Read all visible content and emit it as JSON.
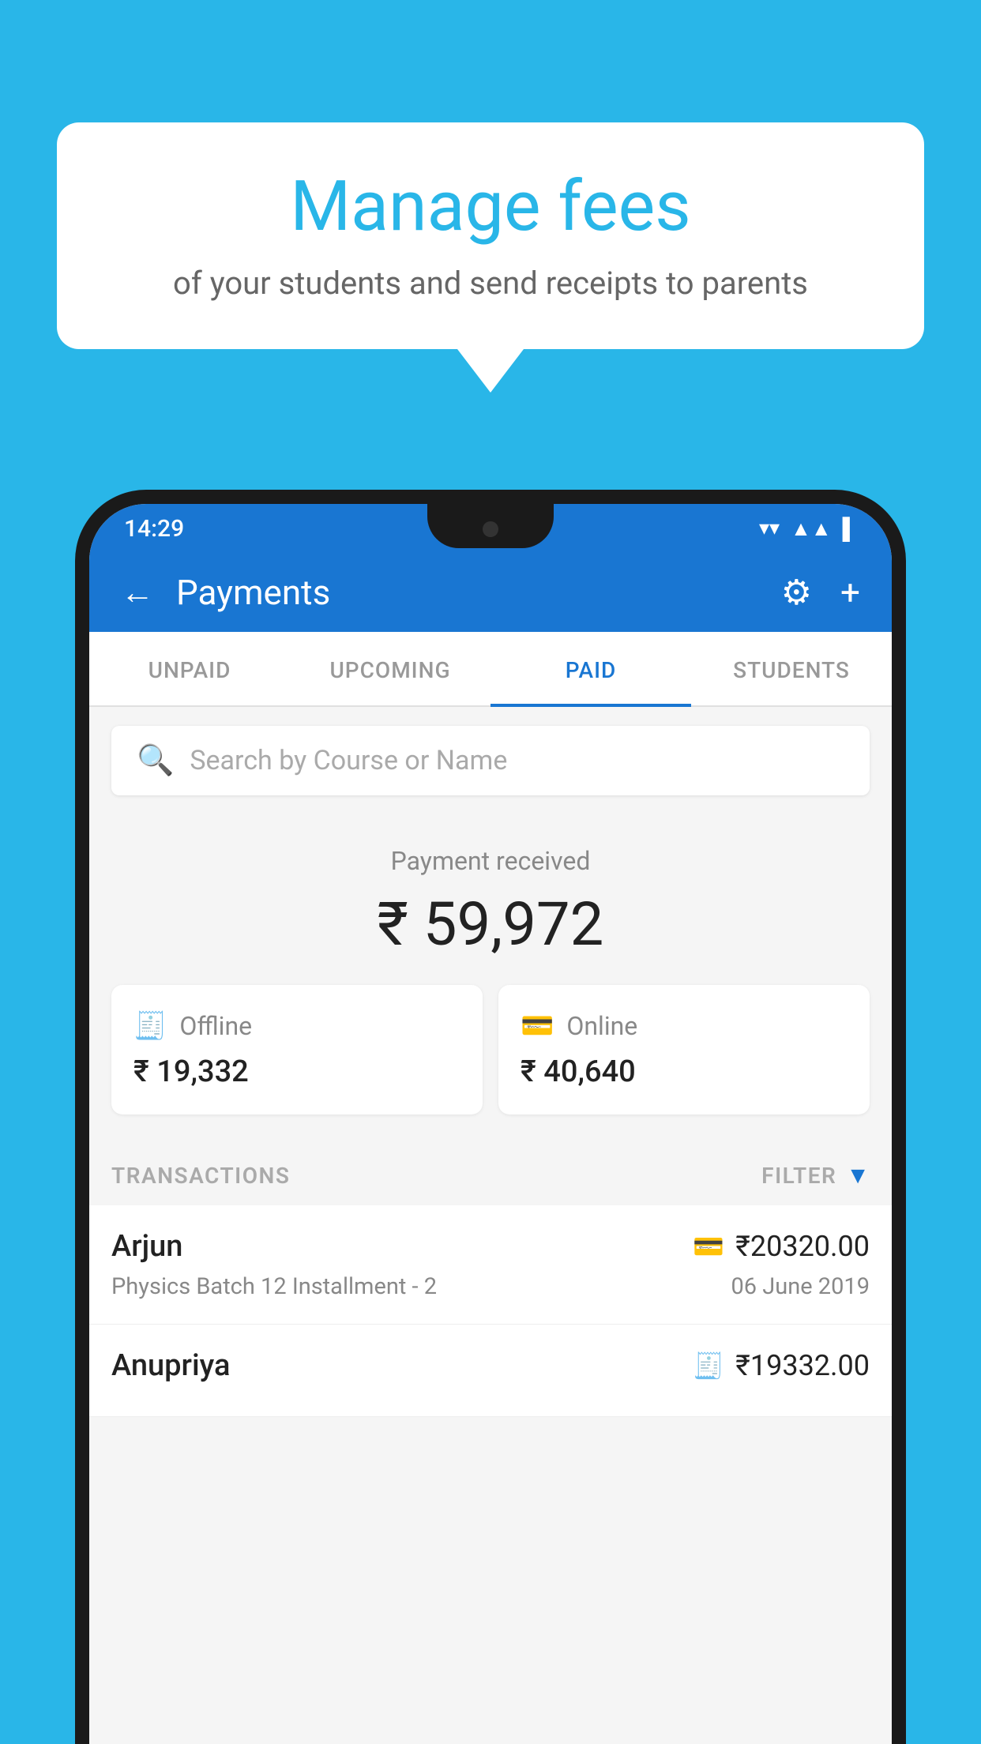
{
  "background": {
    "color": "#29B6E8"
  },
  "speech_bubble": {
    "title": "Manage fees",
    "subtitle": "of your students and send receipts to parents"
  },
  "status_bar": {
    "time": "14:29",
    "wifi_icon": "wifi-icon",
    "signal_icon": "signal-icon",
    "battery_icon": "battery-icon"
  },
  "header": {
    "title": "Payments",
    "back_label": "←",
    "gear_label": "⚙",
    "plus_label": "+"
  },
  "tabs": [
    {
      "label": "UNPAID",
      "active": false
    },
    {
      "label": "UPCOMING",
      "active": false
    },
    {
      "label": "PAID",
      "active": true
    },
    {
      "label": "STUDENTS",
      "active": false
    }
  ],
  "search": {
    "placeholder": "Search by Course or Name"
  },
  "payment_received": {
    "label": "Payment received",
    "amount": "₹ 59,972",
    "offline": {
      "label": "Offline",
      "amount": "₹ 19,332"
    },
    "online": {
      "label": "Online",
      "amount": "₹ 40,640"
    }
  },
  "transactions": {
    "label": "TRANSACTIONS",
    "filter_label": "FILTER",
    "items": [
      {
        "name": "Arjun",
        "detail": "Physics Batch 12 Installment - 2",
        "amount": "₹20320.00",
        "date": "06 June 2019",
        "payment_type": "online"
      },
      {
        "name": "Anupriya",
        "detail": "",
        "amount": "₹19332.00",
        "date": "",
        "payment_type": "offline"
      }
    ]
  }
}
